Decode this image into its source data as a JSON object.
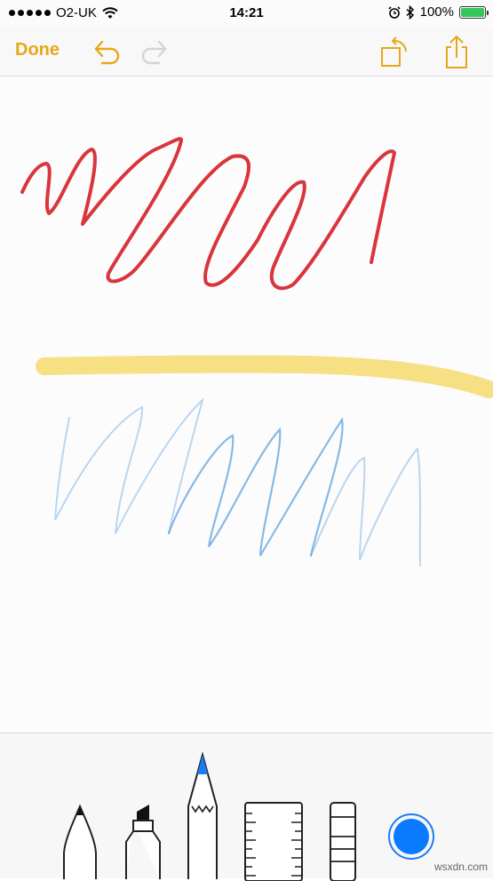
{
  "status_bar": {
    "carrier": "O2-UK",
    "time": "14:21",
    "battery": "100%"
  },
  "toolbar": {
    "done_label": "Done",
    "accent_color": "#e6a817"
  },
  "drawing": {
    "strokes": [
      {
        "tool": "pen",
        "color": "#d9353c"
      },
      {
        "tool": "marker",
        "color": "#f6d55c"
      },
      {
        "tool": "pencil",
        "color": "#6aa8e0"
      }
    ]
  },
  "tools": {
    "items": [
      "pen",
      "marker",
      "pencil",
      "ruler",
      "eraser"
    ],
    "selected": "pencil",
    "current_color": "#0a7bff"
  },
  "watermark": "wsxdn.com"
}
